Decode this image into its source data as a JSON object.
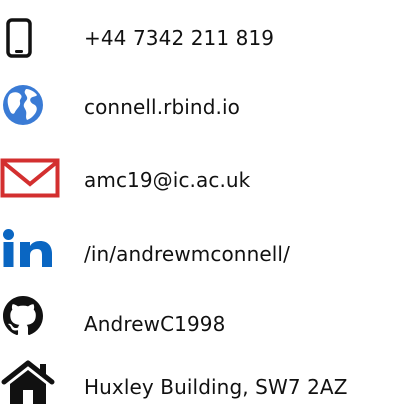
{
  "contacts": [
    {
      "icon": "smartphone-icon",
      "text": "+44 7342 211 819",
      "color": "#111111"
    },
    {
      "icon": "globe-icon",
      "text": "connell.rbind.io",
      "color": "#3a7bd5"
    },
    {
      "icon": "envelope-icon",
      "text": "amc19@ic.ac.uk",
      "color": "#d32f2f"
    },
    {
      "icon": "linkedin-icon",
      "text": "/in/andrewmconnell/",
      "color": "#0a66c2"
    },
    {
      "icon": "github-icon",
      "text": "AndrewC1998",
      "color": "#111111"
    },
    {
      "icon": "home-icon",
      "text": "Huxley Building, SW7 2AZ",
      "color": "#111111"
    }
  ]
}
